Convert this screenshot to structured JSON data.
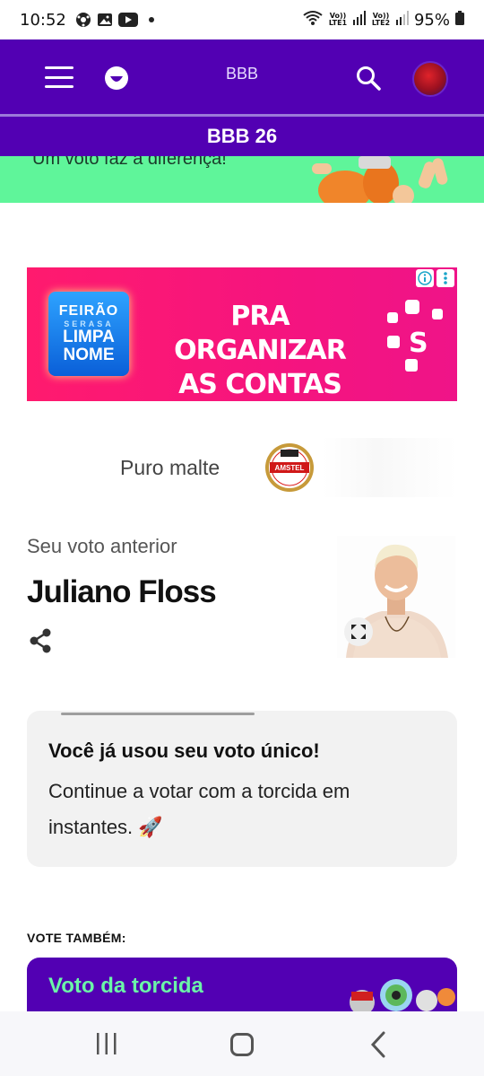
{
  "status_bar": {
    "time": "10:52",
    "icons": [
      "soccer-ball-icon",
      "gallery-icon",
      "youtube-icon",
      "notification-dot-icon"
    ],
    "sim1": "Vo)) LTE1",
    "sim2": "Vo)) LTE2",
    "battery": "95%"
  },
  "header": {
    "title": "BBB",
    "subheader": "BBB 26"
  },
  "banner": {
    "slogan": "Um voto faz a diferença!",
    "color": "#5ff59a"
  },
  "ad": {
    "logo_line1": "FEIRÃO",
    "logo_line2": "SERASA",
    "logo_line3": "LIMPA",
    "logo_line4": "NOME",
    "headline": "PRA ORGANIZAR AS CONTAS",
    "brand_color": "#ff1a6e"
  },
  "sponsor": {
    "text": "Puro malte",
    "logo_text": "AMSTEL"
  },
  "previous_vote": {
    "label": "Seu voto anterior",
    "name": "Juliano Floss"
  },
  "info_card": {
    "title": "Você já usou seu voto único!",
    "body": "Continue a votar com a torcida em instantes. 🚀",
    "progress": 0.5
  },
  "vote_also": {
    "label": "VOTE TAMBÉM:",
    "card_title": "Voto da torcida"
  },
  "colors": {
    "primary": "#5200b3",
    "accent_green": "#6bf5a8"
  }
}
